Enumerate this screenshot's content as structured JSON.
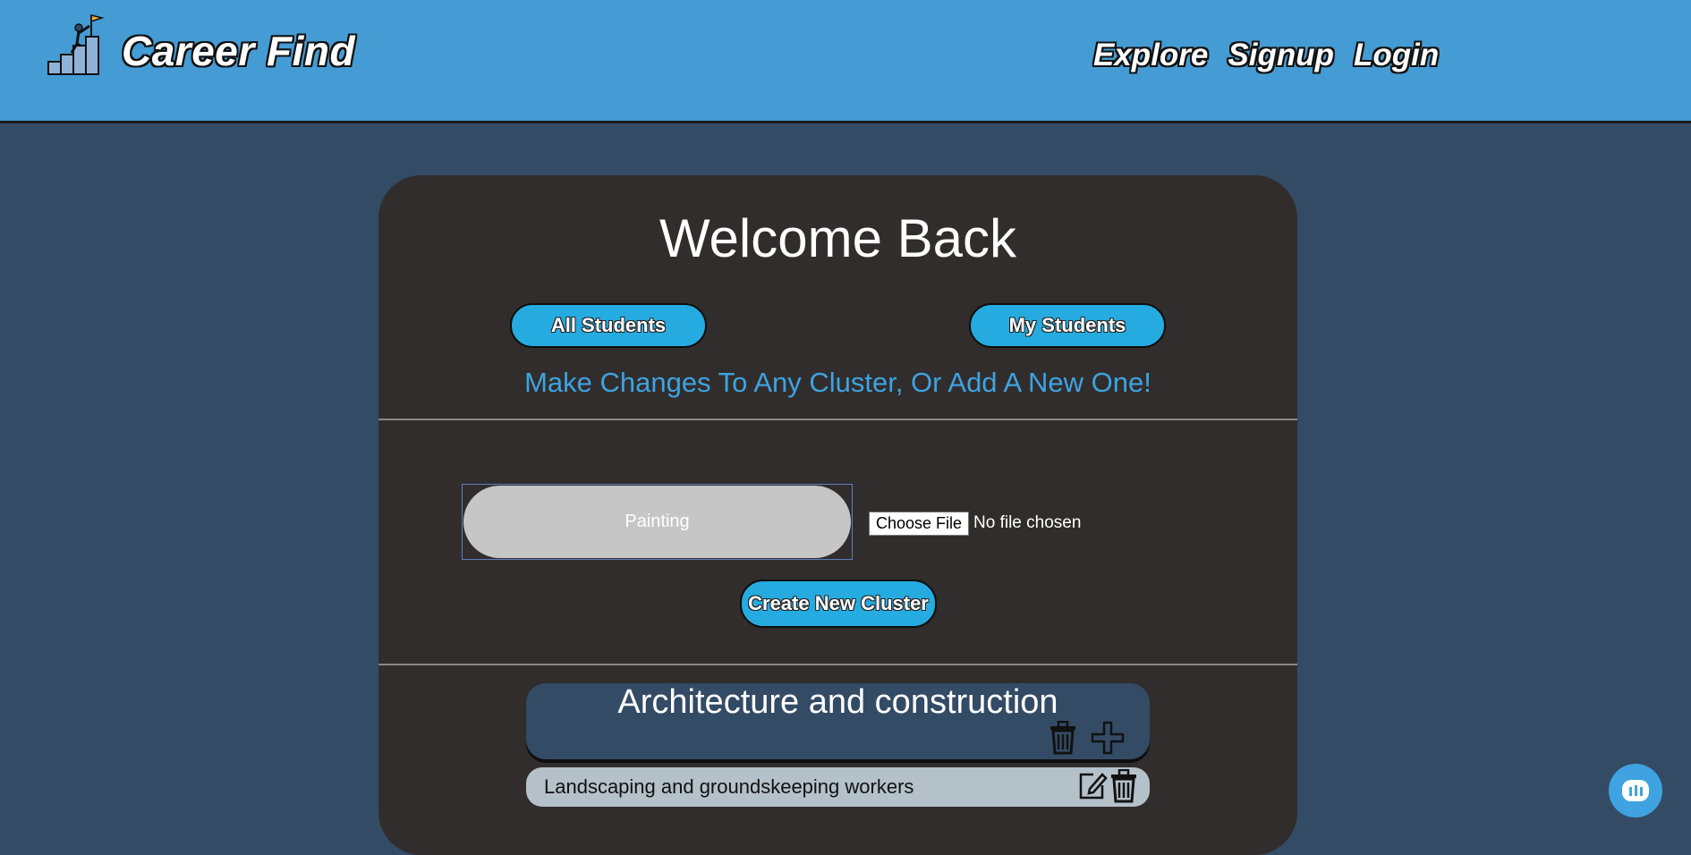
{
  "header": {
    "brand": "Career Find",
    "logo_icon": "climber-flag-icon",
    "nav": [
      "Explore",
      "Signup",
      "Login"
    ]
  },
  "card": {
    "title": "Welcome Back",
    "all_students_label": "All Students",
    "my_students_label": "My Students",
    "subtitle": "Make Changes To Any Cluster, Or Add A New One!",
    "cluster_name_input": {
      "value": "Painting",
      "placeholder": ""
    },
    "file_button_label": "Choose File",
    "file_status": "No file chosen",
    "create_button_label": "Create New Cluster"
  },
  "clusters": [
    {
      "title": "Architecture and construction",
      "icons": [
        "trash-icon",
        "plus-icon"
      ],
      "careers": [
        {
          "label": "Landscaping and groundskeeping workers",
          "icons": [
            "edit-icon",
            "trash-icon"
          ]
        }
      ]
    }
  ],
  "chat": {
    "icon": "chat-icon"
  },
  "colors": {
    "header_bg": "#459bd3",
    "page_bg": "#344b65",
    "card_bg": "#312d2d",
    "accent": "#25abe0",
    "subtitle": "#3ea3e0",
    "input_bg": "#c6c6c6",
    "career_row_bg": "#b4c1c9"
  }
}
